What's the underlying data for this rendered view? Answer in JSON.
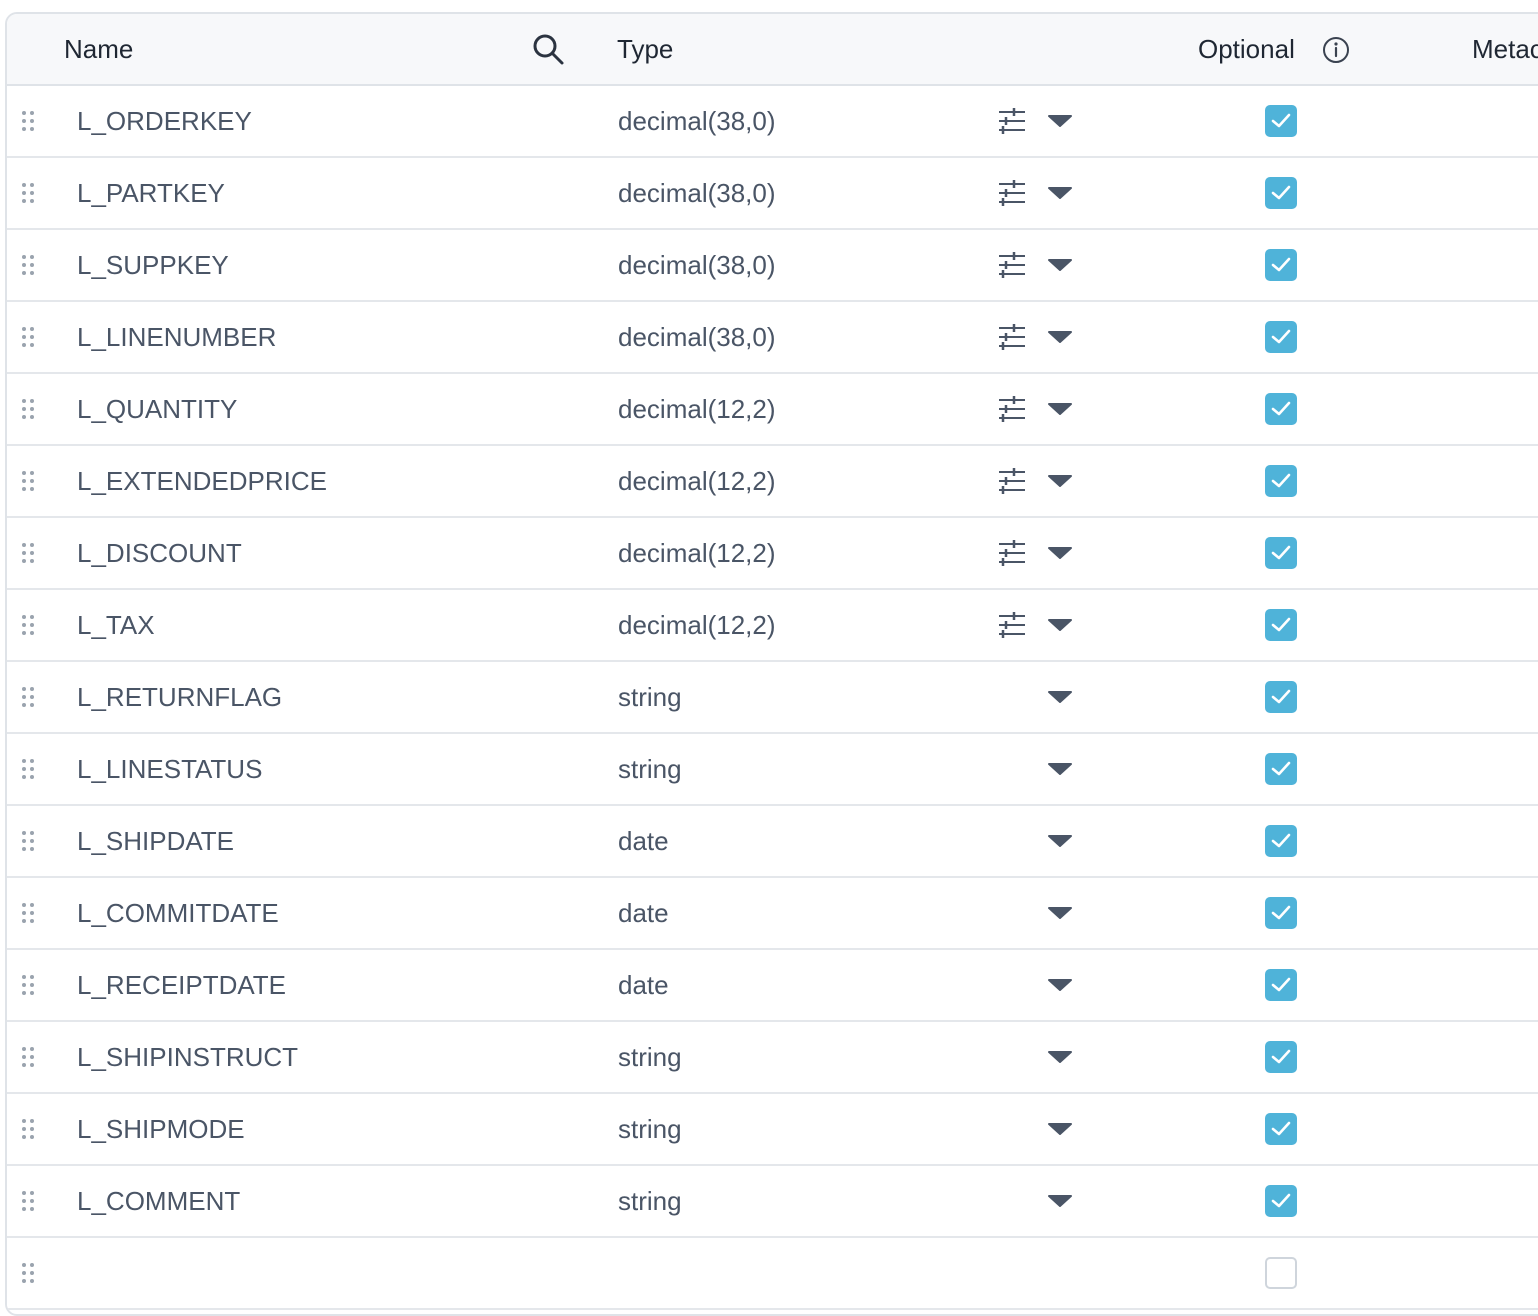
{
  "header": {
    "name_label": "Name",
    "type_label": "Type",
    "optional_label": "Optional",
    "metadata_label": "Metac"
  },
  "colors": {
    "checkbox_checked": "#4fb3d9",
    "header_bg": "#f7f8fa",
    "border": "#dfe3e8",
    "text": "#4a5566"
  },
  "rows": [
    {
      "name": "L_ORDERKEY",
      "type": "decimal(38,0)",
      "has_options": true,
      "optional": true
    },
    {
      "name": "L_PARTKEY",
      "type": "decimal(38,0)",
      "has_options": true,
      "optional": true
    },
    {
      "name": "L_SUPPKEY",
      "type": "decimal(38,0)",
      "has_options": true,
      "optional": true
    },
    {
      "name": "L_LINENUMBER",
      "type": "decimal(38,0)",
      "has_options": true,
      "optional": true
    },
    {
      "name": "L_QUANTITY",
      "type": "decimal(12,2)",
      "has_options": true,
      "optional": true
    },
    {
      "name": "L_EXTENDEDPRICE",
      "type": "decimal(12,2)",
      "has_options": true,
      "optional": true
    },
    {
      "name": "L_DISCOUNT",
      "type": "decimal(12,2)",
      "has_options": true,
      "optional": true
    },
    {
      "name": "L_TAX",
      "type": "decimal(12,2)",
      "has_options": true,
      "optional": true
    },
    {
      "name": "L_RETURNFLAG",
      "type": "string",
      "has_options": false,
      "optional": true
    },
    {
      "name": "L_LINESTATUS",
      "type": "string",
      "has_options": false,
      "optional": true
    },
    {
      "name": "L_SHIPDATE",
      "type": "date",
      "has_options": false,
      "optional": true
    },
    {
      "name": "L_COMMITDATE",
      "type": "date",
      "has_options": false,
      "optional": true
    },
    {
      "name": "L_RECEIPTDATE",
      "type": "date",
      "has_options": false,
      "optional": true
    },
    {
      "name": "L_SHIPINSTRUCT",
      "type": "string",
      "has_options": false,
      "optional": true
    },
    {
      "name": "L_SHIPMODE",
      "type": "string",
      "has_options": false,
      "optional": true
    },
    {
      "name": "L_COMMENT",
      "type": "string",
      "has_options": false,
      "optional": true
    },
    {
      "name": "",
      "type": "",
      "has_options": false,
      "optional": false,
      "caret": false
    }
  ]
}
